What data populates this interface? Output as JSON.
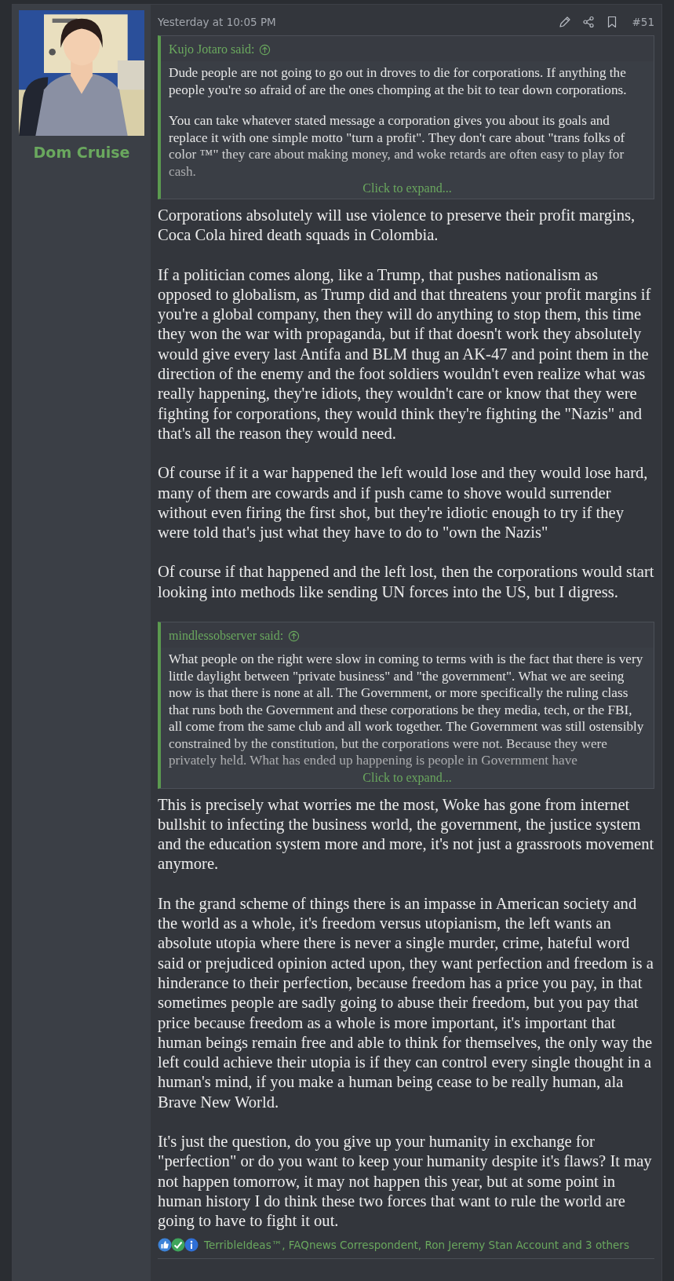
{
  "post": {
    "author": {
      "name": "Dom Cruise"
    },
    "date": "Yesterday at 10:05 PM",
    "number": "#51",
    "blocks": [
      {
        "kind": "quote",
        "author": "Kujo Jotaro said:",
        "paragraphs": [
          "Dude people are not going to go out in droves to die for corporations. If anything the people you're so afraid of are the ones chomping at the bit to tear down corporations.",
          "You can take whatever stated message a corporation gives you about its goals and replace it with one simple motto \"turn a profit\". They don't care about \"trans folks of color ™\" they care about making money, and woke retards are often easy to play for cash."
        ],
        "expand": "Click to expand..."
      },
      {
        "kind": "paragraph",
        "text": "Corporations absolutely will use violence to preserve their profit margins, Coca Cola hired death squads in Colombia."
      },
      {
        "kind": "paragraph",
        "text": "If a politician comes along, like a Trump, that pushes nationalism as opposed to globalism, as Trump did and that threatens your profit margins if you're a global company, then they will do anything to stop them, this time they won the war with propaganda, but if that doesn't work they absolutely would give every last Antifa and BLM thug an AK-47 and point them in the direction of the enemy and the foot soldiers wouldn't even realize what was really happening, they're idiots, they wouldn't care or know that they were fighting for corporations, they would think they're fighting the \"Nazis\" and that's all the reason they would need."
      },
      {
        "kind": "paragraph",
        "text": "Of course if it a war happened the left would lose and they would lose hard, many of them are cowards and if push came to shove would surrender without even firing the first shot, but they're idiotic enough to try if they were told that's just what they have to do to \"own the Nazis\""
      },
      {
        "kind": "paragraph",
        "text": "Of course if that happened and the left lost, then the corporations would start looking into methods like sending UN forces into the US, but I digress."
      },
      {
        "kind": "quote",
        "author": "mindlessobserver said:",
        "paragraphs": [
          "What people on the right were slow in coming to terms with is the fact that there is very little daylight between \"private business\" and \"the government\". What we are seeing now is that there is none at all. The Government, or more specifically the ruling class that runs both the Government and these corporations be they media, tech, or the FBI, all come from the same club and all work together. The Government was still ostensibly constrained by the constitution, but the corporations were not. Because they were privately held. What has ended up happening is people in Government have"
        ],
        "expand": "Click to expand..."
      },
      {
        "kind": "paragraph",
        "text": "This is precisely what worries me the most, Woke has gone from internet bullshit to infecting the business world, the government, the justice system and the education system more and more, it's not just a grassroots movement anymore."
      },
      {
        "kind": "paragraph",
        "text": "In the grand scheme of things there is an impasse in American society and the world as a whole, it's freedom versus utopianism, the left wants an absolute utopia where there is never a single murder, crime, hateful word said or prejudiced opinion acted upon, they want perfection and freedom is a hinderance to their perfection, because freedom has a price you pay, in that sometimes people are sadly going to abuse their freedom, but you pay that price because freedom as a whole is more important, it's important that human beings remain free and able to think for themselves, the only way the left could achieve their utopia is if they can control every single thought in a human's mind, if you make a human being cease to be really human, ala Brave New World."
      },
      {
        "kind": "paragraph",
        "text": "It's just the question, do you give up your humanity in exchange for \"perfection\" or do you want to keep your humanity despite it's flaws? It may not happen tomorrow, it may not happen this year, but at some point in human history I do think these two forces that want to rule the world are going to have to fight it out."
      }
    ],
    "reactions": {
      "icons": [
        {
          "kind": "like"
        },
        {
          "kind": "agree"
        },
        {
          "kind": "informative"
        }
      ],
      "text": "TerribleIdeas™, FAQnews Correspondent, Ron Jeremy Stan Account and 3 others"
    }
  }
}
